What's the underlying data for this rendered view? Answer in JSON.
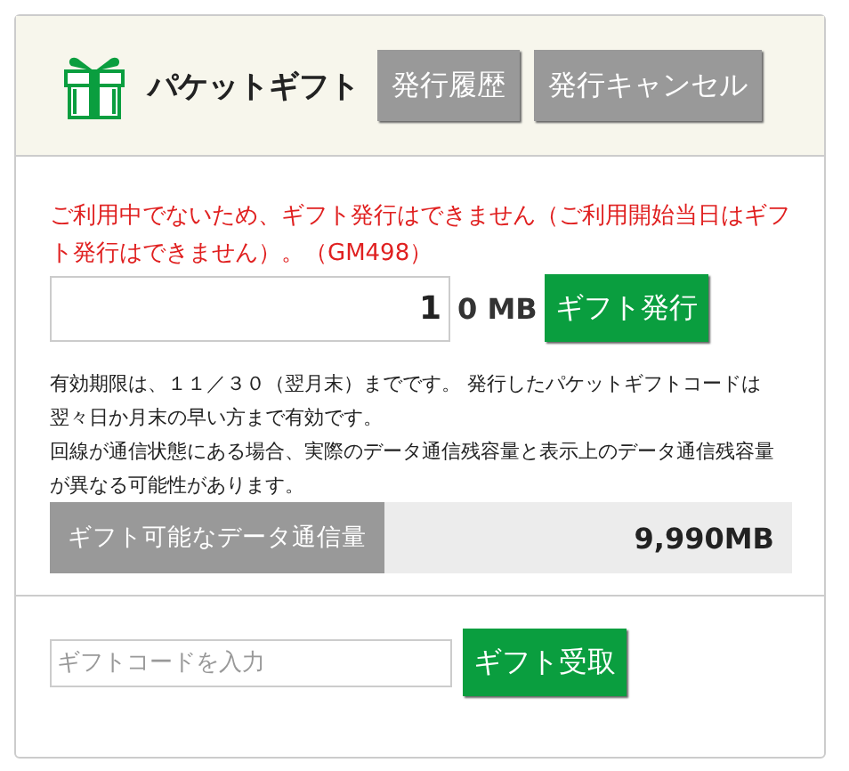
{
  "header": {
    "title": "パケットギフト",
    "buttons": [
      "発行履歴",
      "発行キャンセル"
    ]
  },
  "issue": {
    "error": "ご利用中でないため、ギフト発行はできません（ご利用開始当日はギフト発行はできません）。（GM498）",
    "amount": {
      "value": "1",
      "unit": "0 MB"
    },
    "button": "ギフト発行"
  },
  "notes": [
    "有効期限は、１１／３０（翌月末）までです。 発行したパケットギフトコードは翌々日か月末の早い方まで有効です。",
    "回線が通信状態にある場合、実際のデータ通信残容量と表示上のデータ通信残容量が異なる可能性があります。"
  ],
  "available": {
    "label": "ギフト可能なデータ通信量",
    "value": "9,990MB"
  },
  "receive": {
    "placeholder": "ギフトコードを入力",
    "button": "ギフト受取"
  }
}
